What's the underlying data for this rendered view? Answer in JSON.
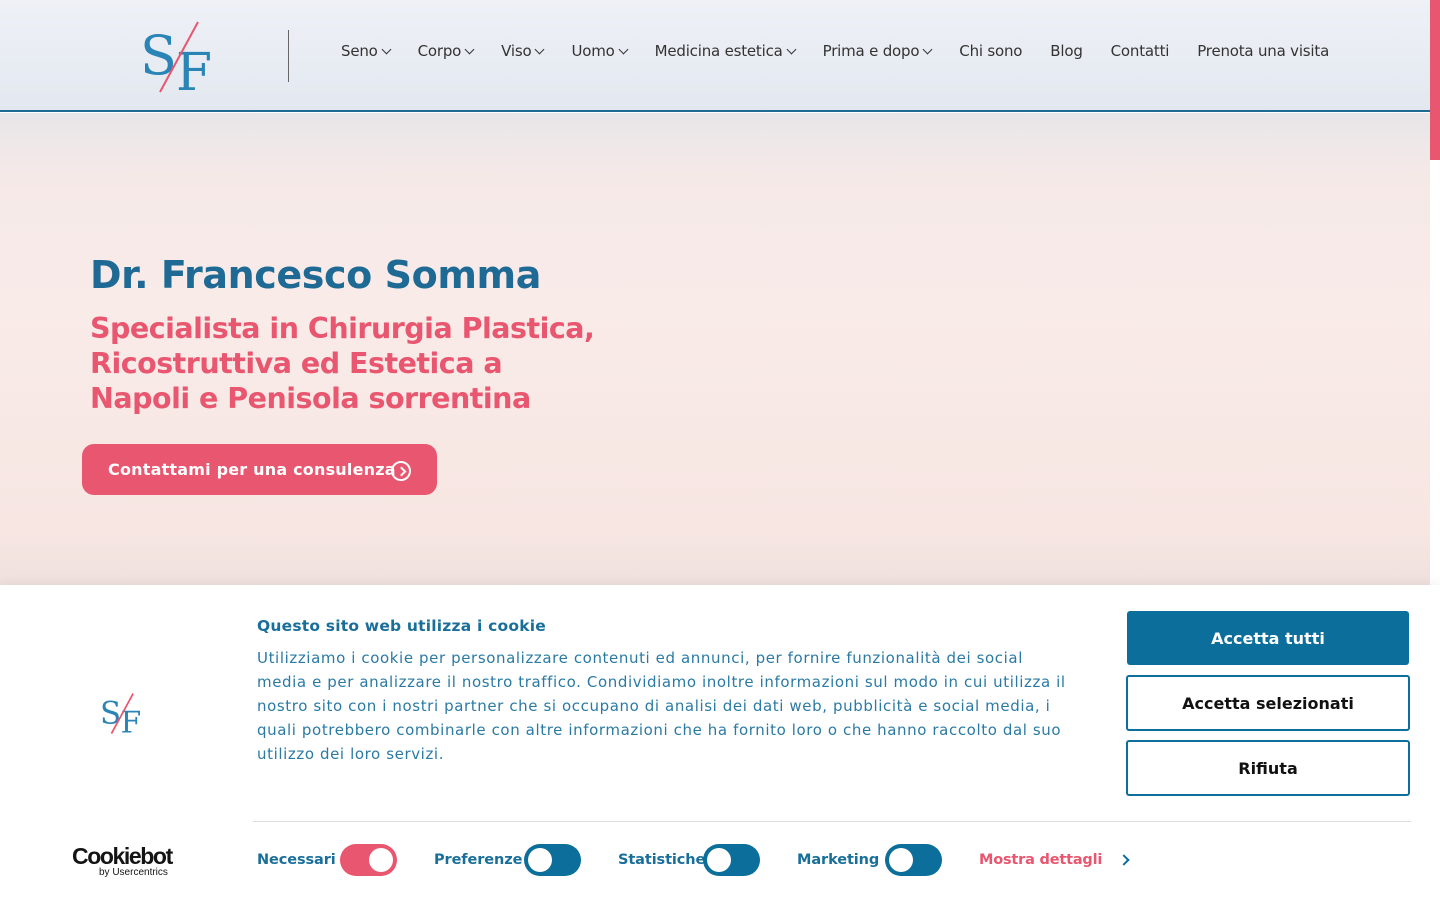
{
  "header": {
    "logo": "SF",
    "nav": [
      {
        "label": "Seno",
        "dropdown": true
      },
      {
        "label": "Corpo",
        "dropdown": true
      },
      {
        "label": "Viso",
        "dropdown": true
      },
      {
        "label": "Uomo",
        "dropdown": true
      },
      {
        "label": "Medicina estetica",
        "dropdown": true
      },
      {
        "label": "Prima e dopo",
        "dropdown": true
      },
      {
        "label": "Chi sono",
        "dropdown": false
      },
      {
        "label": "Blog",
        "dropdown": false
      },
      {
        "label": "Contatti",
        "dropdown": false
      },
      {
        "label": "Prenota una visita",
        "dropdown": false
      }
    ]
  },
  "hero": {
    "title": "Dr. Francesco Somma",
    "subtitle": "Specialista in Chirurgia Plastica, Ricostruttiva ed Estetica a Napoli e Penisola sorrentina",
    "cta_label": "Contattami per una consulenza",
    "cta_icon": "arrow-circle-right-icon"
  },
  "cookie_banner": {
    "title": "Questo sito web utilizza i cookie",
    "text": "Utilizziamo i cookie per personalizzare contenuti ed annunci, per fornire funzionalità dei social media e per analizzare il nostro traffico. Condividiamo inoltre informazioni sul modo in cui utilizza il nostro sito con i nostri partner che si occupano di analisi dei dati web, pubblicità e social media, i quali potrebbero combinarle con altre informazioni che ha fornito loro o che hanno raccolto dal suo utilizzo dei loro servizi.",
    "buttons": {
      "accept_all": "Accetta tutti",
      "accept_selected": "Accetta selezionati",
      "reject": "Rifiuta"
    },
    "brand": {
      "name": "Cookiebot",
      "by": "by Usercentrics"
    },
    "toggles": [
      {
        "label": "Necessari",
        "on": true
      },
      {
        "label": "Preferenze",
        "on": false
      },
      {
        "label": "Statistiche",
        "on": false
      },
      {
        "label": "Marketing",
        "on": false
      }
    ],
    "details_label": "Mostra dettagli"
  },
  "colors": {
    "brand_blue": "#1e6a95",
    "brand_pink": "#e8566f",
    "button_blue": "#0c6e9b"
  }
}
